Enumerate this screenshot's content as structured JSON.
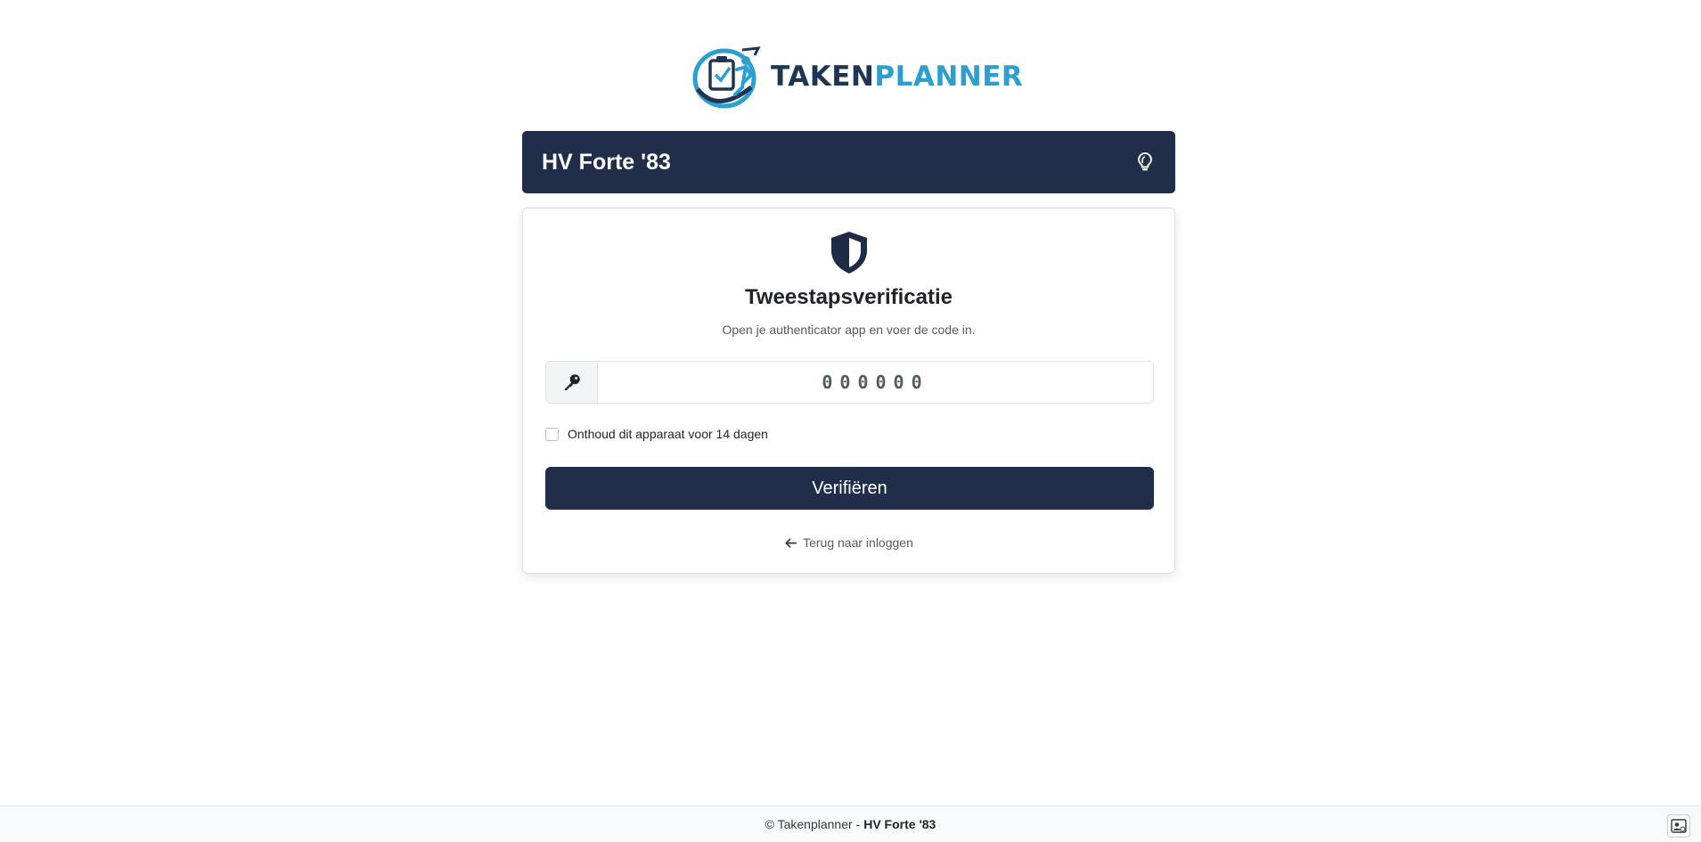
{
  "brand": {
    "logo_part1": "TAKEN",
    "logo_part2": "PLANNER",
    "color_dark": "#1e3553",
    "color_light": "#2a9fd0"
  },
  "header": {
    "org_name": "HV Forte '83",
    "theme_icon": "lightbulb-icon",
    "bar_color": "#212e4a"
  },
  "card": {
    "icon": "shield-icon",
    "title": "Tweestapsverificatie",
    "subtitle": "Open je authenticator app en voer de code in.",
    "code_field": {
      "icon": "key-icon",
      "placeholder": "000000",
      "value": ""
    },
    "remember_label": "Onthoud dit apparaat voor 14 dagen",
    "verify_label": "Verifiëren",
    "back_label": "Terug naar inloggen"
  },
  "footer": {
    "copyright": "© Takenplanner -",
    "org": "HV Forte '83",
    "contact_icon": "contact-card-icon"
  }
}
